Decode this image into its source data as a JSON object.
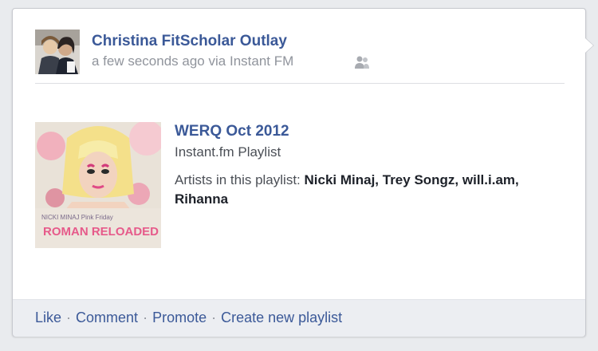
{
  "post": {
    "author": "Christina FitScholar Outlay",
    "timestamp": "a few seconds ago",
    "via_prefix": "via",
    "via_app": "Instant FM",
    "privacy_icon": "friends-icon"
  },
  "attachment": {
    "title": "WERQ Oct 2012",
    "subtitle": "Instant.fm Playlist",
    "artists_prefix": "Artists in this playlist:",
    "artists": "Nicki Minaj, Trey Songz, will.i.am, Rihanna",
    "album_art_text": "ROMAN RELOADED",
    "album_art_caption": "NICKI MINAJ  Pink Friday"
  },
  "actions": {
    "like": "Like",
    "comment": "Comment",
    "promote": "Promote",
    "create_playlist": "Create new playlist",
    "separator": "·"
  },
  "colors": {
    "link": "#3b5998",
    "meta": "#90949c",
    "footer_bg": "#eceef2"
  }
}
